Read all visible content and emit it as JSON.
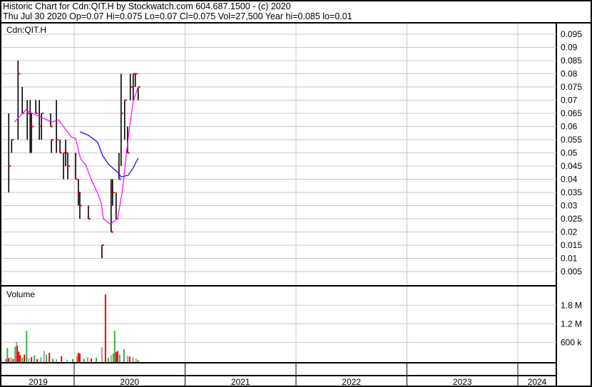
{
  "header": {
    "title": "Historic Chart for Cdn:QIT.H by Stockwatch.com 604.687.1500 - (c) 2020",
    "summary": "Thu Jul 30 2020  Op=0.07  Hi=0.075  Lo=0.07  Cl=0.075  Vol=27,500  Year hi=0.085  lo=0.01"
  },
  "colors": {
    "up": "#3cb043",
    "down": "#ff0000",
    "unchanged": "#a0a0a0",
    "ma_short": "#ff00ff",
    "ma_long": "#0000ff",
    "grid": "#c8c8c8",
    "close_tick": "#ff0000"
  },
  "chart_data": [
    {
      "type": "ohlc",
      "title": "Cdn:QIT.H",
      "x_unit": "decimal year",
      "xlim": [
        2019.35,
        2025.0
      ],
      "ylim": [
        0,
        0.1
      ],
      "grid": true,
      "y_ticks": [
        0.095,
        0.09,
        0.085,
        0.08,
        0.075,
        0.07,
        0.065,
        0.06,
        0.055,
        0.05,
        0.045,
        0.04,
        0.035,
        0.03,
        0.025,
        0.02,
        0.015,
        0.01,
        0.005
      ],
      "y_tick_labels": [
        "0.095",
        "0.09",
        "0.085",
        "0.08",
        "0.075",
        "0.07",
        "0.065",
        "0.06",
        "0.055",
        "0.05",
        "0.045",
        "0.04",
        "0.035",
        "0.03",
        "0.025",
        "0.02",
        "0.015",
        "0.01",
        "0.005"
      ],
      "bars": [
        {
          "x": 2019.41,
          "h": 0.065,
          "l": 0.035,
          "c": 0.045
        },
        {
          "x": 2019.436,
          "h": 0.055,
          "l": 0.05,
          "c": 0.055
        },
        {
          "x": 2019.494,
          "h": 0.085,
          "l": 0.055,
          "c": 0.08
        },
        {
          "x": 2019.532,
          "h": 0.075,
          "l": 0.065,
          "c": 0.065
        },
        {
          "x": 2019.577,
          "h": 0.07,
          "l": 0.055,
          "c": 0.065
        },
        {
          "x": 2019.603,
          "h": 0.07,
          "l": 0.05,
          "c": 0.06
        },
        {
          "x": 2019.615,
          "h": 0.065,
          "l": 0.05,
          "c": 0.06
        },
        {
          "x": 2019.654,
          "h": 0.07,
          "l": 0.065,
          "c": 0.065
        },
        {
          "x": 2019.686,
          "h": 0.07,
          "l": 0.055,
          "c": 0.06
        },
        {
          "x": 2019.705,
          "h": 0.065,
          "l": 0.055,
          "c": 0.065
        },
        {
          "x": 2019.788,
          "h": 0.065,
          "l": 0.06,
          "c": 0.06
        },
        {
          "x": 2019.795,
          "h": 0.055,
          "l": 0.05,
          "c": 0.055
        },
        {
          "x": 2019.84,
          "h": 0.07,
          "l": 0.05,
          "c": 0.055
        },
        {
          "x": 2019.872,
          "h": 0.055,
          "l": 0.05,
          "c": 0.05
        },
        {
          "x": 2019.904,
          "h": 0.05,
          "l": 0.04,
          "c": 0.05
        },
        {
          "x": 2019.923,
          "h": 0.055,
          "l": 0.045,
          "c": 0.05
        },
        {
          "x": 2019.942,
          "h": 0.05,
          "l": 0.04,
          "c": 0.045
        },
        {
          "x": 2020.013,
          "h": 0.05,
          "l": 0.04,
          "c": 0.04
        },
        {
          "x": 2020.038,
          "h": 0.04,
          "l": 0.03,
          "c": 0.035
        },
        {
          "x": 2020.051,
          "h": 0.035,
          "l": 0.025,
          "c": 0.03
        },
        {
          "x": 2020.128,
          "h": 0.03,
          "l": 0.025,
          "c": 0.025
        },
        {
          "x": 2020.25,
          "h": 0.015,
          "l": 0.01,
          "c": 0.015
        },
        {
          "x": 2020.333,
          "h": 0.04,
          "l": 0.02,
          "c": 0.02
        },
        {
          "x": 2020.346,
          "h": 0.04,
          "l": 0.03,
          "c": 0.035
        },
        {
          "x": 2020.378,
          "h": 0.035,
          "l": 0.025,
          "c": 0.025
        },
        {
          "x": 2020.404,
          "h": 0.05,
          "l": 0.04,
          "c": 0.04
        },
        {
          "x": 2020.423,
          "h": 0.08,
          "l": 0.045,
          "c": 0.065
        },
        {
          "x": 2020.455,
          "h": 0.07,
          "l": 0.055,
          "c": 0.07
        },
        {
          "x": 2020.481,
          "h": 0.06,
          "l": 0.05,
          "c": 0.05
        },
        {
          "x": 2020.506,
          "h": 0.08,
          "l": 0.07,
          "c": 0.075
        },
        {
          "x": 2020.532,
          "h": 0.08,
          "l": 0.07,
          "c": 0.08
        },
        {
          "x": 2020.551,
          "h": 0.08,
          "l": 0.075,
          "c": 0.08
        },
        {
          "x": 2020.577,
          "h": 0.075,
          "l": 0.07,
          "c": 0.075
        }
      ],
      "series": [
        {
          "name": "short moving average",
          "color_key": "ma_short",
          "points": [
            [
              2019.462,
              0.0617
            ],
            [
              2019.564,
              0.0663
            ],
            [
              2019.609,
              0.0653
            ],
            [
              2019.795,
              0.0617
            ],
            [
              2019.859,
              0.0625
            ],
            [
              2019.974,
              0.056
            ],
            [
              2020.013,
              0.0555
            ],
            [
              2020.058,
              0.0477
            ],
            [
              2020.103,
              0.0455
            ],
            [
              2020.154,
              0.04
            ],
            [
              2020.212,
              0.0346
            ],
            [
              2020.244,
              0.031
            ],
            [
              2020.263,
              0.025
            ],
            [
              2020.327,
              0.023
            ],
            [
              2020.391,
              0.025
            ],
            [
              2020.436,
              0.036
            ],
            [
              2020.468,
              0.049
            ],
            [
              2020.5,
              0.06
            ],
            [
              2020.532,
              0.0695
            ],
            [
              2020.577,
              0.075
            ]
          ]
        },
        {
          "name": "long moving average",
          "color_key": "ma_long",
          "points": [
            [
              2020.051,
              0.058
            ],
            [
              2020.128,
              0.0567
            ],
            [
              2020.212,
              0.054
            ],
            [
              2020.256,
              0.049
            ],
            [
              2020.314,
              0.0455
            ],
            [
              2020.397,
              0.0425
            ],
            [
              2020.423,
              0.0409
            ],
            [
              2020.487,
              0.0415
            ],
            [
              2020.532,
              0.0443
            ],
            [
              2020.577,
              0.048
            ]
          ]
        }
      ]
    },
    {
      "type": "bar",
      "title": "Volume",
      "ylim": [
        0,
        2400000
      ],
      "y_ticks": [
        600000,
        1200000,
        1800000
      ],
      "y_tick_labels": [
        "600 k",
        "1.2 M",
        "1.8 M"
      ],
      "bars": [
        {
          "x": 2019.385,
          "v": 60000,
          "d": "up"
        },
        {
          "x": 2019.398,
          "v": 420000,
          "d": "up"
        },
        {
          "x": 2019.41,
          "v": 90000,
          "d": "down"
        },
        {
          "x": 2019.43,
          "v": 110000,
          "d": "unchanged"
        },
        {
          "x": 2019.449,
          "v": 60000,
          "d": "down"
        },
        {
          "x": 2019.468,
          "v": 460000,
          "d": "up"
        },
        {
          "x": 2019.481,
          "v": 620000,
          "d": "unchanged"
        },
        {
          "x": 2019.487,
          "v": 490000,
          "d": "down"
        },
        {
          "x": 2019.5,
          "v": 300000,
          "d": "down"
        },
        {
          "x": 2019.513,
          "v": 180000,
          "d": "down"
        },
        {
          "x": 2019.532,
          "v": 100000,
          "d": "up"
        },
        {
          "x": 2019.551,
          "v": 200000,
          "d": "red"
        },
        {
          "x": 2019.571,
          "v": 975000,
          "d": "up"
        },
        {
          "x": 2019.59,
          "v": 80000,
          "d": "unchanged"
        },
        {
          "x": 2019.615,
          "v": 120000,
          "d": "down"
        },
        {
          "x": 2019.641,
          "v": 180000,
          "d": "up"
        },
        {
          "x": 2019.667,
          "v": 60000,
          "d": "down"
        },
        {
          "x": 2019.699,
          "v": 120000,
          "d": "unchanged"
        },
        {
          "x": 2019.728,
          "v": 320000,
          "d": "unchanged"
        },
        {
          "x": 2019.75,
          "v": 200000,
          "d": "up"
        },
        {
          "x": 2019.776,
          "v": 260000,
          "d": "down"
        },
        {
          "x": 2019.808,
          "v": 70000,
          "d": "up"
        },
        {
          "x": 2019.84,
          "v": 60000,
          "d": "unchanged"
        },
        {
          "x": 2019.885,
          "v": 150000,
          "d": "down"
        },
        {
          "x": 2019.936,
          "v": 40000,
          "d": "unchanged"
        },
        {
          "x": 2019.987,
          "v": 60000,
          "d": "up"
        },
        {
          "x": 2020.026,
          "v": 170000,
          "d": "unchanged"
        },
        {
          "x": 2020.038,
          "v": 260000,
          "d": "down"
        },
        {
          "x": 2020.051,
          "v": 240000,
          "d": "down"
        },
        {
          "x": 2020.09,
          "v": 60000,
          "d": "up"
        },
        {
          "x": 2020.122,
          "v": 120000,
          "d": "unchanged"
        },
        {
          "x": 2020.154,
          "v": 80000,
          "d": "down"
        },
        {
          "x": 2020.199,
          "v": 100000,
          "d": "up"
        },
        {
          "x": 2020.25,
          "v": 440000,
          "d": "unchanged"
        },
        {
          "x": 2020.282,
          "v": 2150000,
          "d": "down"
        },
        {
          "x": 2020.308,
          "v": 100000,
          "d": "up"
        },
        {
          "x": 2020.333,
          "v": 180000,
          "d": "unchanged"
        },
        {
          "x": 2020.353,
          "v": 240000,
          "d": "up"
        },
        {
          "x": 2020.365,
          "v": 975000,
          "d": "up"
        },
        {
          "x": 2020.378,
          "v": 280000,
          "d": "down"
        },
        {
          "x": 2020.391,
          "v": 320000,
          "d": "down"
        },
        {
          "x": 2020.41,
          "v": 200000,
          "d": "up"
        },
        {
          "x": 2020.449,
          "v": 375000,
          "d": "up"
        },
        {
          "x": 2020.481,
          "v": 160000,
          "d": "unchanged"
        },
        {
          "x": 2020.5,
          "v": 140000,
          "d": "down"
        },
        {
          "x": 2020.532,
          "v": 120000,
          "d": "unchanged"
        },
        {
          "x": 2020.558,
          "v": 70000,
          "d": "unchanged"
        },
        {
          "x": 2020.577,
          "v": 27500,
          "d": "up"
        }
      ]
    }
  ],
  "x_axis": {
    "year_labels": [
      "2019",
      "2020",
      "2021",
      "2022",
      "2023",
      "2024"
    ],
    "year_boundaries": [
      2020,
      2021,
      2022,
      2023,
      2024
    ]
  }
}
